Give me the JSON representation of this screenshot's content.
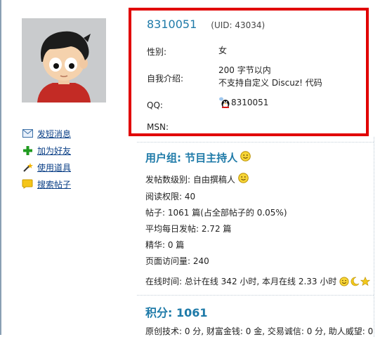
{
  "profile": {
    "username": "8310051",
    "uid": "(UID: 43034)",
    "gender_label": "性别:",
    "gender_value": "女",
    "bio_label": "自我介绍:",
    "bio_line1": "200 字节以内",
    "bio_line2": "不支持自定义 Discuz! 代码",
    "qq_label": "QQ:",
    "qq_value": "8310051",
    "msn_label": "MSN:",
    "msn_value": ""
  },
  "actions": [
    {
      "label": "发短消息",
      "icon": "envelope-icon"
    },
    {
      "label": "加为好友",
      "icon": "plus-icon"
    },
    {
      "label": "使用道具",
      "icon": "magic-wand-icon"
    },
    {
      "label": "搜索帖子",
      "icon": "search-bubble-icon"
    }
  ],
  "group": {
    "title": "用户组: 节目主持人"
  },
  "stats": {
    "post_level": "发帖数级别: 自由撰稿人",
    "read_perm": "阅读权限: 40",
    "posts": "帖子: 1061 篇(占全部帖子的 0.05%)",
    "daily_posts": "平均每日发帖: 2.72 篇",
    "digest": "精华: 0 篇",
    "page_views": "页面访问量: 240",
    "online_time": "在线时间: 总计在线 342 小时, 本月在线 2.33 小时"
  },
  "score": {
    "title": "积分: 1061",
    "detail": "原创技术: 0 分, 财富金钱: 0 金, 交易诚信: 0 分, 助人威望: 0"
  },
  "colors": {
    "highlight_border": "#e10000",
    "link": "#0a3f86",
    "title": "#1e7aa8"
  }
}
